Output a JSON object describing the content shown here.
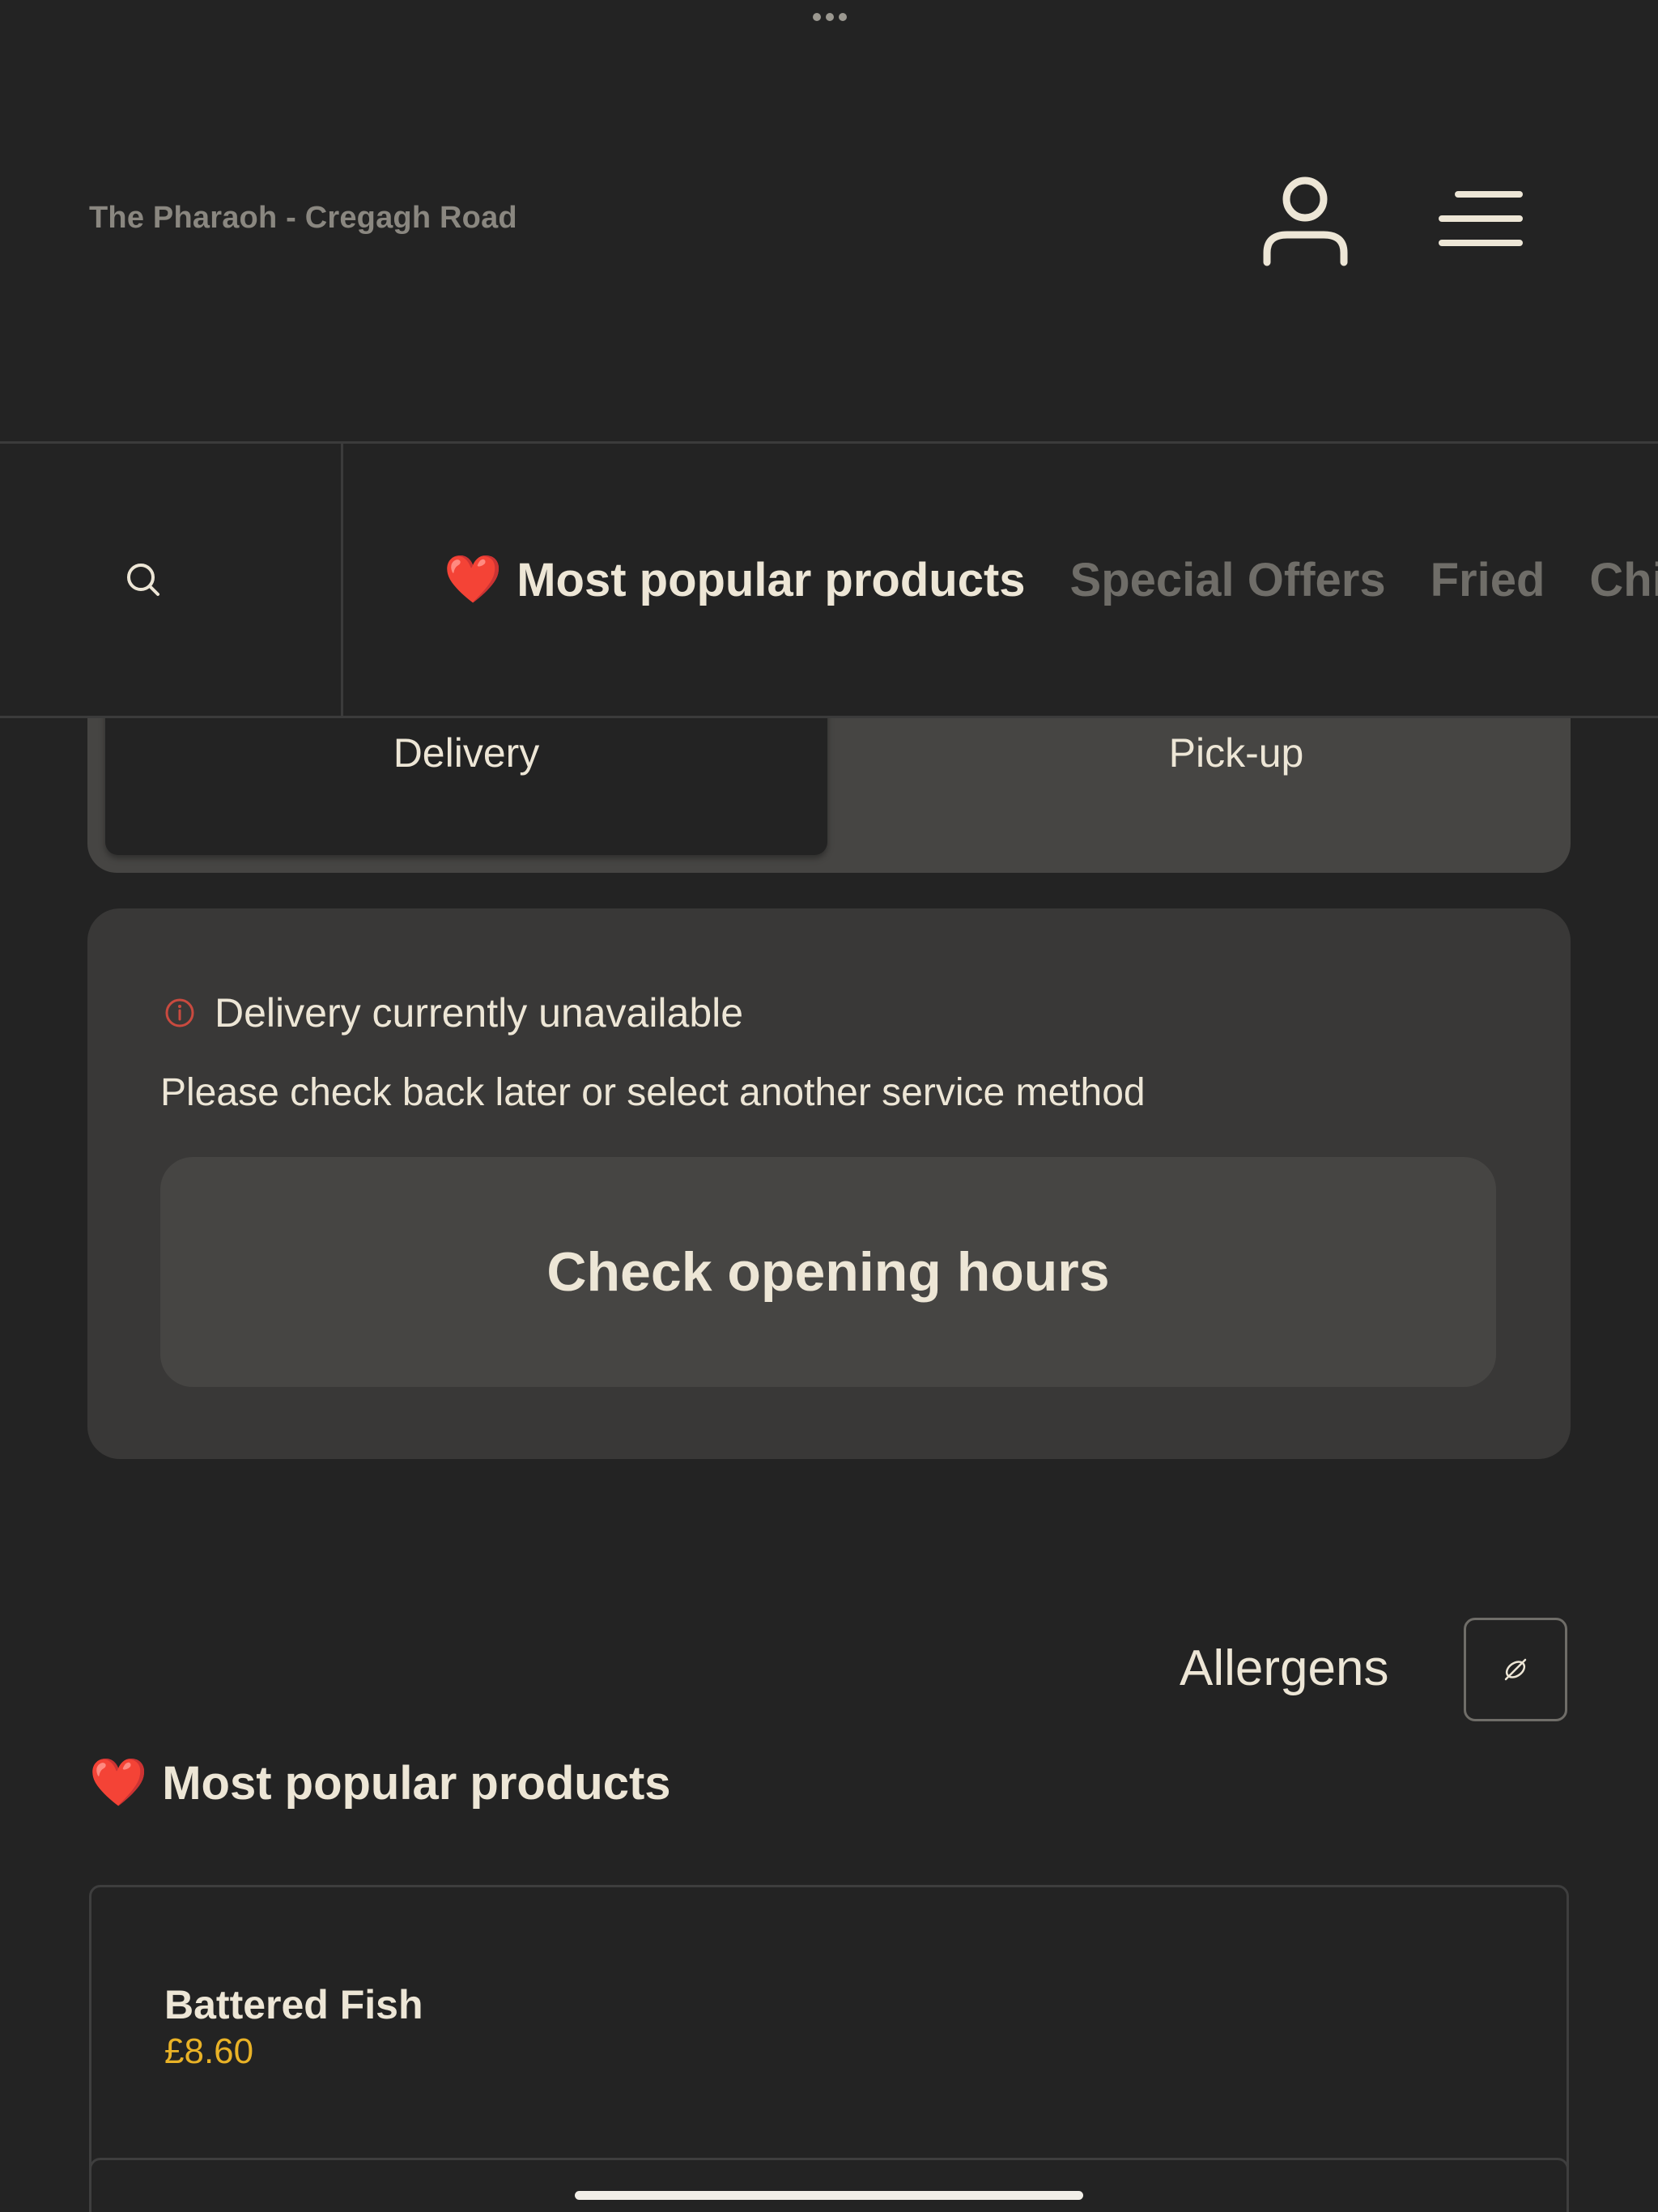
{
  "header": {
    "restaurant_name": "The Pharaoh - Cregagh Road",
    "user_icon": "user-icon",
    "menu_icon": "hamburger-menu-icon"
  },
  "nav": {
    "search_icon": "search-icon",
    "categories": [
      {
        "label": "Most popular products",
        "emoji": "❤️",
        "active": true
      },
      {
        "label": "Special Offers",
        "active": false
      },
      {
        "label": "Fried",
        "active": false
      },
      {
        "label": "Chi",
        "active": false
      }
    ]
  },
  "service": {
    "options": [
      "Delivery",
      "Pick-up"
    ],
    "selected": "Delivery"
  },
  "status": {
    "title": "Delivery currently unavailable",
    "message": "Please check back later or select another service method",
    "button_label": "Check opening hours",
    "alert_color": "#c94a3f"
  },
  "allergens": {
    "label": "Allergens",
    "icon": "allergen-filter-icon"
  },
  "section": {
    "emoji": "❤️",
    "title": "Most popular products"
  },
  "products": [
    {
      "name": "Battered Fish",
      "price": "£8.60"
    }
  ],
  "colors": {
    "background": "#232323",
    "text": "#ede6d6",
    "muted": "#6f6d68",
    "price": "#e9b227",
    "card": "#393837"
  }
}
